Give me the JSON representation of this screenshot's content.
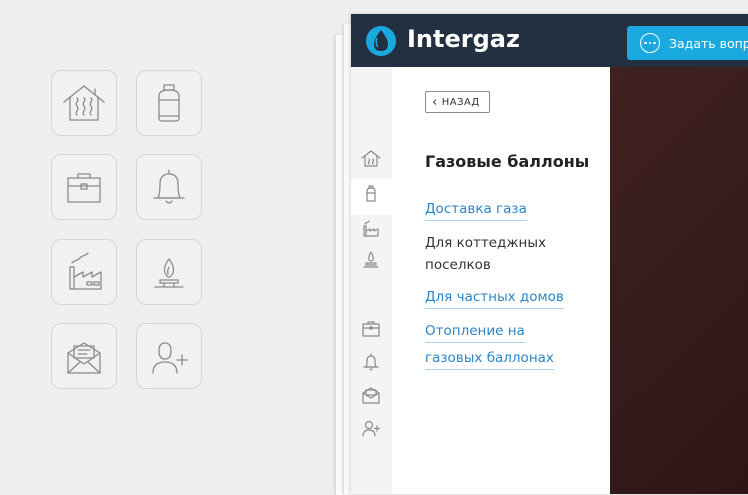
{
  "brand": {
    "name": "Intergaz",
    "accent": "#1aa9df",
    "topbar_color": "#233041"
  },
  "header": {
    "ask_button_label": "Задать вопрос"
  },
  "menu": {
    "back_label": "НАЗАД",
    "title": "Газовые баллоны",
    "items": [
      {
        "label": "Доставка газа",
        "link": true
      },
      {
        "label_line1": "Для коттеджных",
        "label_line2": "поселков",
        "link": false
      },
      {
        "label": "Для частных домов",
        "link": true
      },
      {
        "label_line1": "Отопление на",
        "label_line2": "газовых баллонах",
        "link": true
      }
    ]
  },
  "tiles": [
    "house-heating-icon",
    "gas-cylinder-icon",
    "briefcase-icon",
    "bell-icon",
    "factory-icon",
    "gas-burner-icon",
    "mail-icon",
    "add-user-icon"
  ],
  "rail_icons": [
    "house-heating-icon",
    "gas-cylinder-icon",
    "factory-icon",
    "gas-burner-icon",
    "briefcase-icon",
    "bell-icon",
    "mail-icon",
    "add-user-icon"
  ]
}
